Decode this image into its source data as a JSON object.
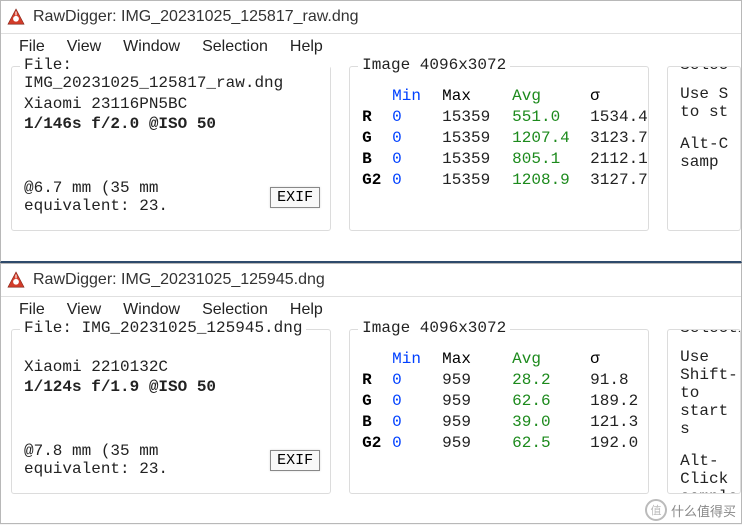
{
  "windows": [
    {
      "title": "RawDigger: IMG_20231025_125817_raw.dng",
      "menus": [
        "File",
        "View",
        "Window",
        "Selection",
        "Help"
      ],
      "file": {
        "legend": "File: IMG_20231025_125817_raw.dng",
        "camera": "Xiaomi 23116PN5BC",
        "exposure": "1/146s f/2.0 @ISO 50",
        "focal": "@6.7 mm (35 mm equivalent: 23.",
        "exif_label": "EXIF"
      },
      "image": {
        "legend": "Image 4096x3072",
        "header": {
          "min": "Min",
          "max": "Max",
          "avg": "Avg",
          "sigma": "σ"
        },
        "rows": [
          {
            "ch": "R",
            "min": "0",
            "max": "15359",
            "avg": "551.0",
            "sigma": "1534.4"
          },
          {
            "ch": "G",
            "min": "0",
            "max": "15359",
            "avg": "1207.4",
            "sigma": "3123.7"
          },
          {
            "ch": "B",
            "min": "0",
            "max": "15359",
            "avg": "805.1",
            "sigma": "2112.1"
          },
          {
            "ch": "G2",
            "min": "0",
            "max": "15359",
            "avg": "1208.9",
            "sigma": "3127.7"
          }
        ]
      },
      "selection": {
        "legend": "Selec",
        "line1": "Use S",
        "line2": "to st",
        "line3": "Alt-C",
        "line4": "samp"
      }
    },
    {
      "title": "RawDigger: IMG_20231025_125945.dng",
      "menus": [
        "File",
        "View",
        "Window",
        "Selection",
        "Help"
      ],
      "file": {
        "legend": "File: IMG_20231025_125945.dng",
        "camera": "Xiaomi 2210132C",
        "exposure": "1/124s f/1.9 @ISO 50",
        "focal": "@7.8 mm (35 mm equivalent: 23.",
        "exif_label": "EXIF"
      },
      "image": {
        "legend": "Image 4096x3072",
        "header": {
          "min": "Min",
          "max": "Max",
          "avg": "Avg",
          "sigma": "σ"
        },
        "rows": [
          {
            "ch": "R",
            "min": "0",
            "max": "959",
            "avg": "28.2",
            "sigma": "91.8"
          },
          {
            "ch": "G",
            "min": "0",
            "max": "959",
            "avg": "62.6",
            "sigma": "189.2"
          },
          {
            "ch": "B",
            "min": "0",
            "max": "959",
            "avg": "39.0",
            "sigma": "121.3"
          },
          {
            "ch": "G2",
            "min": "0",
            "max": "959",
            "avg": "62.5",
            "sigma": "192.0"
          }
        ]
      },
      "selection": {
        "legend": "Selection/",
        "line1": "Use Shift-",
        "line2": "to start s",
        "line3": "Alt-Click",
        "line4": "sample"
      }
    }
  ],
  "watermark": "什么值得买"
}
